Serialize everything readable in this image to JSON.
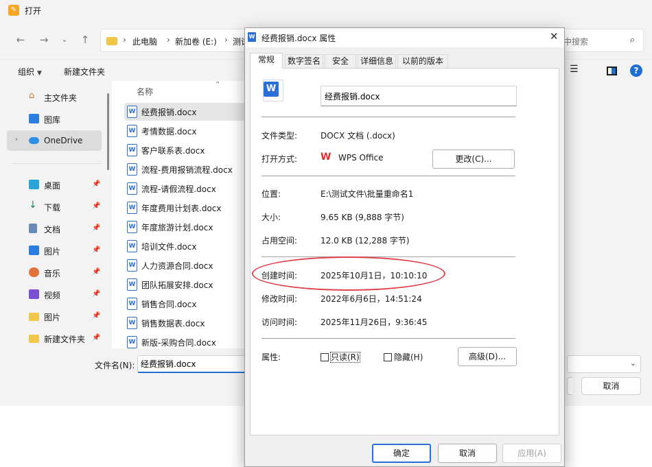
{
  "open_dialog": {
    "title": "打开",
    "breadcrumbs": [
      "此电脑",
      "新加卷 (E:)",
      "测试"
    ],
    "search_placeholder": "中搜索",
    "toolbar": {
      "organize": "组织",
      "new_folder": "新建文件夹"
    },
    "sidebar": {
      "top_items": [
        {
          "label": "主文件夹",
          "icon": "home-icon"
        },
        {
          "label": "图库",
          "icon": "gallery-icon"
        },
        {
          "label": "OneDrive",
          "icon": "cloud-icon"
        }
      ],
      "quick_items": [
        {
          "label": "桌面",
          "icon": "desktop-icon"
        },
        {
          "label": "下载",
          "icon": "download-icon"
        },
        {
          "label": "文档",
          "icon": "document-icon"
        },
        {
          "label": "图片",
          "icon": "picture-icon"
        },
        {
          "label": "音乐",
          "icon": "music-icon"
        },
        {
          "label": "视频",
          "icon": "video-icon"
        },
        {
          "label": "图片",
          "icon": "folder-icon"
        },
        {
          "label": "新建文件夹",
          "icon": "folder-icon"
        }
      ]
    },
    "filelist": {
      "column_header": "名称",
      "files": [
        "经费报销.docx",
        "考情数据.docx",
        "客户联系表.docx",
        "流程-费用报销流程.docx",
        "流程-请假流程.docx",
        "年度费用计划表.docx",
        "年度旅游计划.docx",
        "培训文件.docx",
        "人力资源合同.docx",
        "团队拓展安排.docx",
        "销售合同.docx",
        "销售数据表.docx",
        "新版-采购合同.docx"
      ]
    },
    "filename_label": "文件名(N):",
    "filename_value": "经费报销.docx",
    "cancel_label": "取消"
  },
  "properties": {
    "title": "经费报销.docx 属性",
    "tabs": [
      "常规",
      "数字签名",
      "安全",
      "详细信息",
      "以前的版本"
    ],
    "file_name": "经费报销.docx",
    "rows": {
      "file_type_label": "文件类型:",
      "file_type_value": "DOCX 文档 (.docx)",
      "opens_with_label": "打开方式:",
      "opens_with_value": "WPS Office",
      "change_button": "更改(C)...",
      "location_label": "位置:",
      "location_value": "E:\\测试文件\\批量重命名1",
      "size_label": "大小:",
      "size_value": "9.65 KB (9,888 字节)",
      "size_on_disk_label": "占用空间:",
      "size_on_disk_value": "12.0 KB (12,288 字节)",
      "created_label": "创建时间:",
      "created_value": "2025年10月1日，10:10:10",
      "modified_label": "修改时间:",
      "modified_value": "2022年6月6日，14:51:24",
      "accessed_label": "访问时间:",
      "accessed_value": "2025年11月26日，9:36:45",
      "attributes_label": "属性:",
      "readonly_label": "只读(R)",
      "hidden_label": "隐藏(H)",
      "advanced_button": "高级(D)..."
    },
    "buttons": {
      "ok": "确定",
      "cancel": "取消",
      "apply": "应用(A)"
    }
  },
  "colors": {
    "highlight_ellipse": "#e0434b",
    "accent": "#1f6fd1",
    "word_blue": "#2b6fd6"
  }
}
